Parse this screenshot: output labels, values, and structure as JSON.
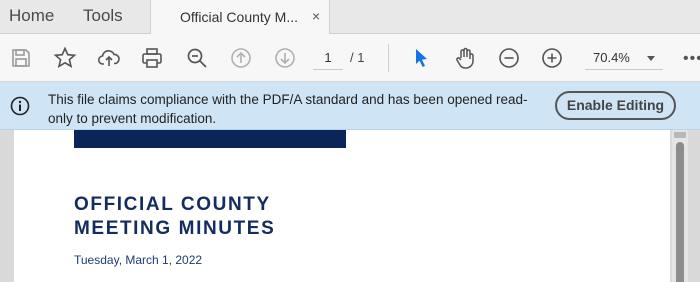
{
  "tabbar": {
    "home_label": "Home",
    "tools_label": "Tools",
    "doc_tab_title": "Official County M...",
    "close_glyph": "×"
  },
  "toolbar": {
    "icons": [
      "save-icon",
      "star-icon",
      "cloud-upload-icon",
      "print-icon",
      "search-zoom-icon",
      "page-up-icon",
      "page-down-icon",
      "select-cursor-icon",
      "hand-icon",
      "zoom-out-icon",
      "zoom-in-icon",
      "more-icon"
    ],
    "current_page": "1",
    "total_pages": "/ 1",
    "zoom_value": "70.4%",
    "more_glyph": "•••",
    "accent_color": "#1473e6"
  },
  "banner": {
    "message": "This file claims compliance with the PDF/A standard and has been opened read-only to prevent modification.",
    "button_label": "Enable Editing",
    "background": "#cfe4f5"
  },
  "document": {
    "title_line1": "OFFICIAL COUNTY",
    "title_line2": "MEETING MINUTES",
    "date": "Tuesday, March 1, 2022",
    "brand_color": "#0c2558"
  }
}
